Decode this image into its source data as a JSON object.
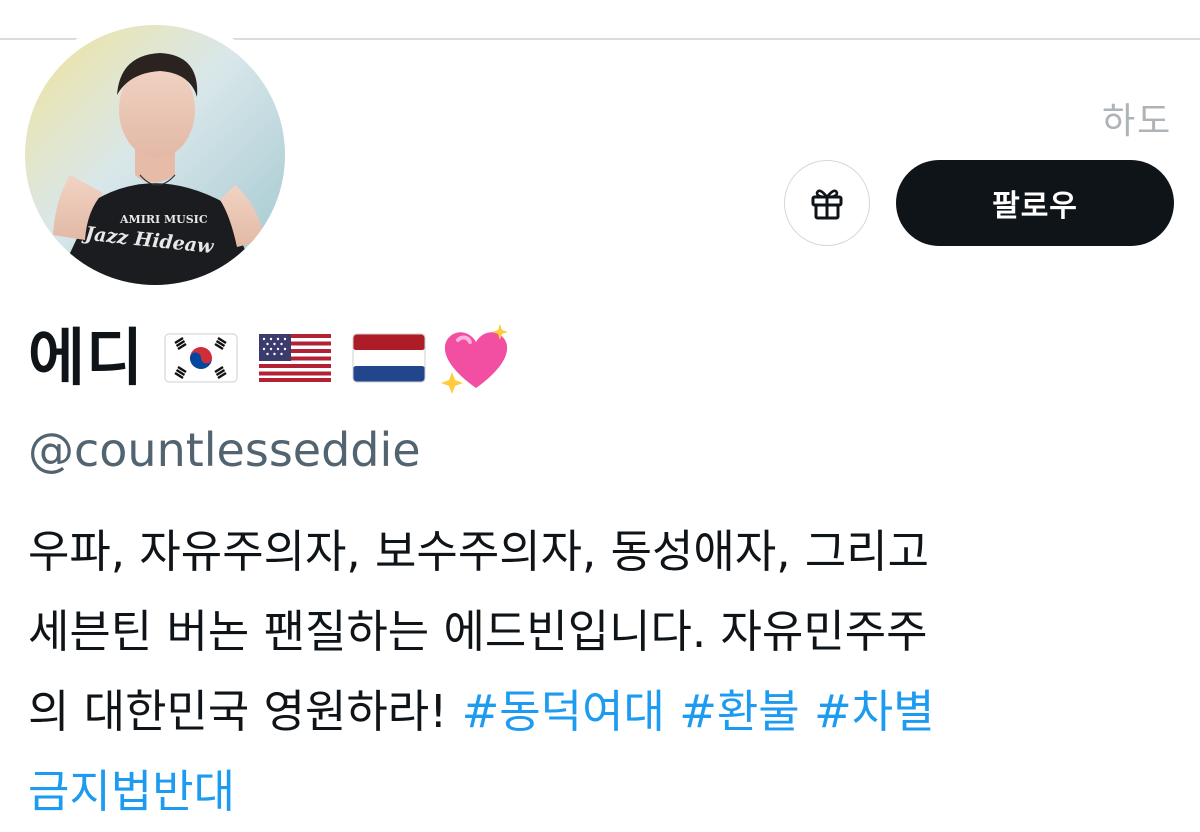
{
  "header": {
    "corner_text": "하도"
  },
  "profile": {
    "display_name": "에디",
    "flags": [
      "south-korea-flag",
      "united-states-flag",
      "netherlands-flag"
    ],
    "emoji": "sparkling-heart",
    "handle": "@countlesseddie"
  },
  "actions": {
    "gift_icon": "gift-icon",
    "follow_label": "팔로우"
  },
  "bio": {
    "line1": "우파, 자유주의자, 보수주의자, 동성애자, 그리고",
    "line2": "세븐틴 버논 팬질하는 에드빈입니다. 자유민주주",
    "line3_text": "의 대한민국 영원하라! ",
    "hashtags": [
      "#동덕여대",
      "#환불",
      "#차별",
      "금지법반대"
    ]
  },
  "colors": {
    "text": "#0f1419",
    "secondary": "#536471",
    "link": "#1d9bf0",
    "button_bg": "#0f1419",
    "button_text": "#ffffff"
  }
}
